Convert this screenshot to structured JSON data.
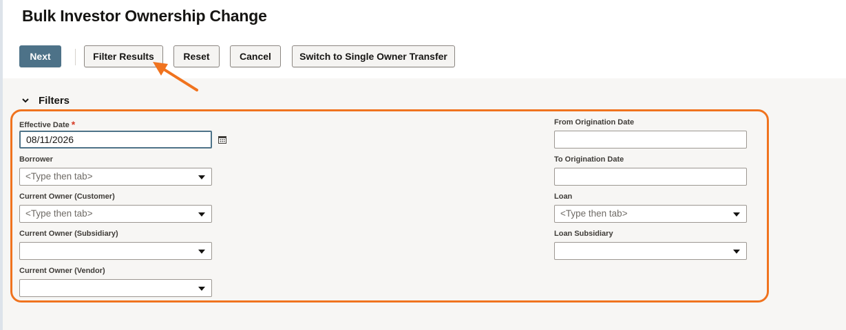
{
  "page": {
    "title": "Bulk Investor Ownership Change"
  },
  "toolbar": {
    "next": "Next",
    "filter_results": "Filter Results",
    "reset": "Reset",
    "cancel": "Cancel",
    "switch_single": "Switch to Single Owner Transfer"
  },
  "filters": {
    "title": "Filters",
    "effective_date": {
      "label": "Effective Date",
      "required_mark": "*",
      "value": "08/11/2026"
    },
    "borrower": {
      "label": "Borrower",
      "placeholder": "<Type then tab>"
    },
    "current_owner_customer": {
      "label": "Current Owner (Customer)",
      "placeholder": "<Type then tab>"
    },
    "current_owner_subsidiary": {
      "label": "Current Owner (Subsidiary)",
      "value": ""
    },
    "current_owner_vendor": {
      "label": "Current Owner (Vendor)",
      "value": ""
    },
    "from_origination_date": {
      "label": "From Origination Date",
      "value": ""
    },
    "to_origination_date": {
      "label": "To Origination Date",
      "value": ""
    },
    "loan": {
      "label": "Loan",
      "placeholder": "<Type then tab>"
    },
    "loan_subsidiary": {
      "label": "Loan Subsidiary",
      "value": ""
    }
  },
  "icons": {
    "calendar": "calendar-icon",
    "collapse": "chevron-down-icon",
    "dropdown": "caret-down-icon"
  },
  "colors": {
    "primary_button": "#4d7288",
    "annotation": "#f0731e",
    "required": "#d63b25"
  }
}
